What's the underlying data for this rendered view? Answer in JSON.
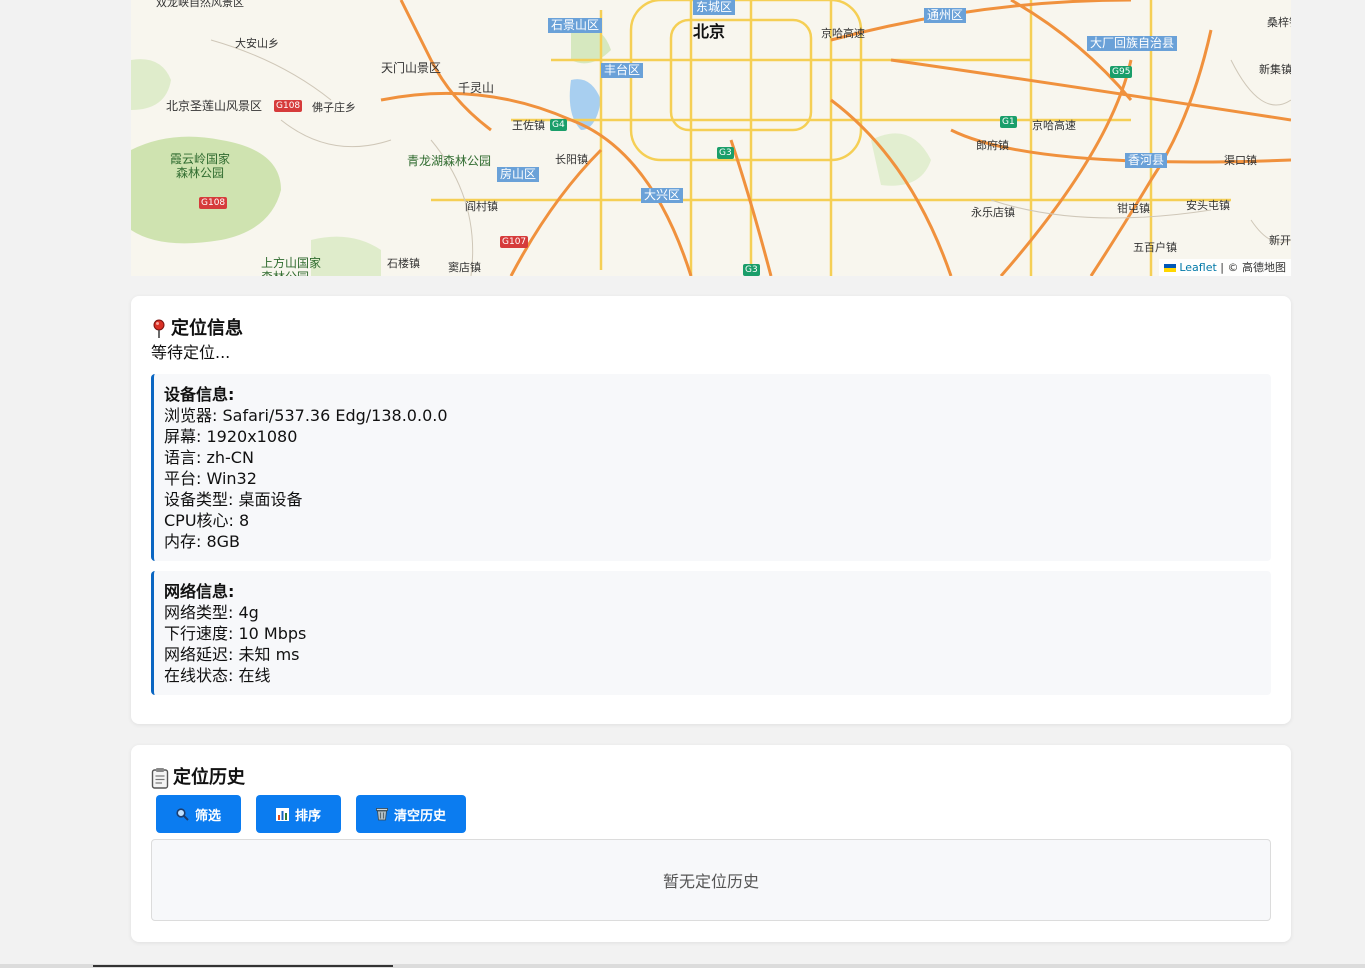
{
  "map": {
    "city": "北京",
    "districts": [
      "东城区",
      "石景山区",
      "丰台区",
      "通州区",
      "大兴区",
      "房山区",
      "大厂回族自治县",
      "香河县"
    ],
    "places": [
      "双龙峡自然风景区",
      "大安山乡",
      "天门山景区",
      "千灵山",
      "北京圣莲山风景区",
      "佛子庄乡",
      "王佐镇",
      "长阳镇",
      "阎村镇",
      "石楼镇",
      "窦店镇",
      "京哈高速",
      "郎府镇",
      "永乐店镇",
      "钳屯镇",
      "安头屯镇",
      "五百户镇",
      "渠口镇",
      "新集镇",
      "桑梓镇",
      "新开",
      "京哈高速"
    ],
    "parks": [
      "青龙湖森林公园",
      "霞云岭国家森林公园",
      "上方山国家森林公园"
    ],
    "highways": [
      "G108",
      "G108",
      "G4",
      "G3",
      "G107",
      "G3",
      "G95",
      "G1"
    ],
    "attribution_link": "Leaflet",
    "attribution_text": "| © 高德地图"
  },
  "location_card": {
    "icon": "pin-icon",
    "title": "定位信息",
    "status": "等待定位...",
    "device": {
      "heading": "设备信息:",
      "browser": "浏览器: Safari/537.36 Edg/138.0.0.0",
      "screen": "屏幕: 1920x1080",
      "language": "语言: zh-CN",
      "platform": "平台: Win32",
      "device_type": "设备类型: 桌面设备",
      "cpu": "CPU核心: 8",
      "memory": "内存: 8GB"
    },
    "network": {
      "heading": "网络信息:",
      "type": "网络类型: 4g",
      "downlink": "下行速度: 10 Mbps",
      "rtt": "网络延迟: 未知 ms",
      "online": "在线状态: 在线"
    }
  },
  "history_card": {
    "icon": "clipboard-icon",
    "title": "定位历史",
    "buttons": {
      "filter": "筛选",
      "sort": "排序",
      "clear": "清空历史"
    },
    "empty_text": "暂无定位历史"
  },
  "colors": {
    "primary": "#0b7cf0",
    "accent_border": "#0a66c2",
    "map_background": "#f8f6ee",
    "district_label": "#6aa1d8"
  }
}
